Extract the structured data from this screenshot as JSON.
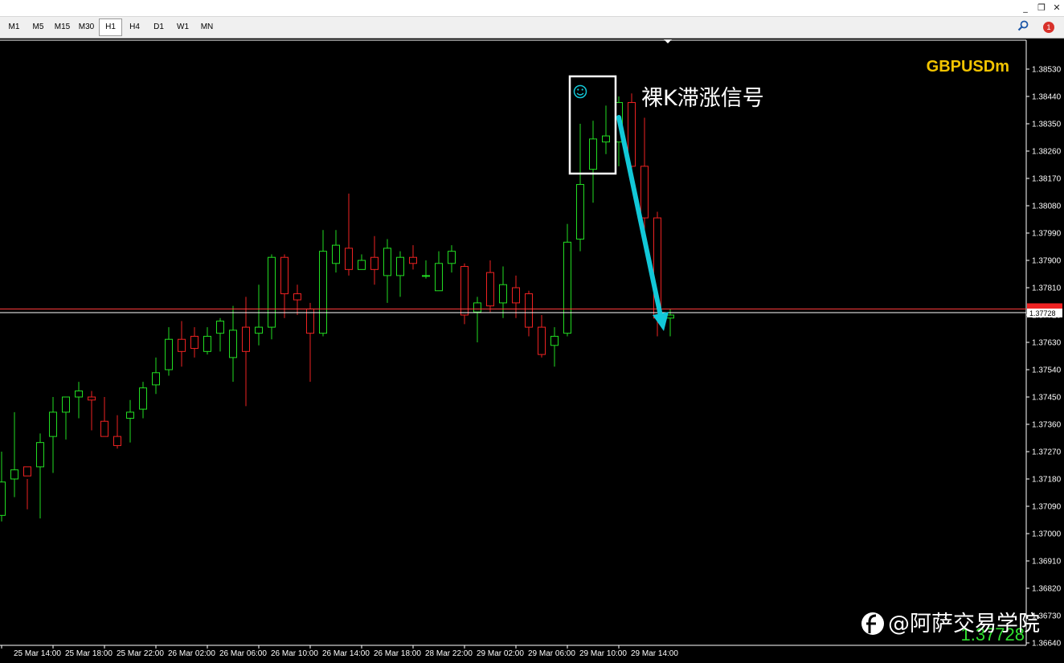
{
  "window": {
    "minimize_icon": "minimize-icon",
    "restore_icon": "restore-icon",
    "close_icon": "close-icon"
  },
  "toolbar": {
    "timeframes": [
      "M1",
      "M5",
      "M15",
      "M30",
      "H1",
      "H4",
      "D1",
      "W1",
      "MN"
    ],
    "active_timeframe": "H1",
    "search_icon": "search-icon",
    "notification_icon": "chat-bubble-icon",
    "notification_count": "1"
  },
  "chart_data": {
    "type": "candlestick",
    "symbol": "GBPUSDm",
    "timeframe": "H1",
    "colors": {
      "bull": "#22dd22",
      "bear": "#ee2222",
      "background": "#000000",
      "annotation_box": "#ffffff",
      "arrow": "#12c8d8"
    },
    "y_axis": {
      "min": 1.3664,
      "max": 1.3853,
      "ticks": [
        "1.38530",
        "1.38440",
        "1.38350",
        "1.38260",
        "1.38170",
        "1.38080",
        "1.37990",
        "1.37900",
        "1.37810",
        "1.37720",
        "1.37630",
        "1.37540",
        "1.37450",
        "1.37360",
        "1.37270",
        "1.37180",
        "1.37090",
        "1.37000",
        "1.36910",
        "1.36820",
        "1.36730",
        "1.36640"
      ]
    },
    "x_axis": {
      "labels": [
        "25 Mar 14:00",
        "25 Mar 18:00",
        "25 Mar 22:00",
        "26 Mar 02:00",
        "26 Mar 06:00",
        "26 Mar 10:00",
        "26 Mar 14:00",
        "26 Mar 18:00",
        "28 Mar 22:00",
        "29 Mar 02:00",
        "29 Mar 06:00",
        "29 Mar 10:00",
        "29 Mar 14:00"
      ]
    },
    "current_price": "1.37728",
    "ask_line_price": 1.3774,
    "bid_display": "1.37728",
    "candles": [
      [
        1.3706,
        1.3727,
        1.3704,
        1.3717
      ],
      [
        1.3718,
        1.374,
        1.3712,
        1.3721
      ],
      [
        1.3722,
        1.3718,
        1.3708,
        1.3719
      ],
      [
        1.3722,
        1.3733,
        1.3705,
        1.373
      ],
      [
        1.3732,
        1.3745,
        1.372,
        1.374
      ],
      [
        1.374,
        1.3742,
        1.3731,
        1.3745
      ],
      [
        1.3745,
        1.375,
        1.3738,
        1.3747
      ],
      [
        1.3745,
        1.3747,
        1.3734,
        1.3744
      ],
      [
        1.3737,
        1.3745,
        1.3733,
        1.3732
      ],
      [
        1.3732,
        1.3739,
        1.3728,
        1.3729
      ],
      [
        1.3738,
        1.3744,
        1.373,
        1.374
      ],
      [
        1.3741,
        1.375,
        1.3738,
        1.3748
      ],
      [
        1.3749,
        1.3758,
        1.3746,
        1.3753
      ],
      [
        1.3754,
        1.3768,
        1.3752,
        1.3764
      ],
      [
        1.3764,
        1.377,
        1.3755,
        1.376
      ],
      [
        1.3765,
        1.3768,
        1.3758,
        1.3761
      ],
      [
        1.376,
        1.3768,
        1.3759,
        1.3765
      ],
      [
        1.3766,
        1.3771,
        1.376,
        1.377
      ],
      [
        1.3758,
        1.3775,
        1.375,
        1.3767
      ],
      [
        1.3768,
        1.3778,
        1.3742,
        1.376
      ],
      [
        1.3766,
        1.3782,
        1.3762,
        1.3768
      ],
      [
        1.3768,
        1.3792,
        1.3764,
        1.3791
      ],
      [
        1.3791,
        1.3792,
        1.3771,
        1.3779
      ],
      [
        1.3779,
        1.3782,
        1.3772,
        1.3777
      ],
      [
        1.3774,
        1.3776,
        1.375,
        1.3766
      ],
      [
        1.3766,
        1.38,
        1.3765,
        1.3793
      ],
      [
        1.3789,
        1.38,
        1.3786,
        1.3795
      ],
      [
        1.3794,
        1.3812,
        1.3785,
        1.3787
      ],
      [
        1.3787,
        1.3792,
        1.3787,
        1.379
      ],
      [
        1.3791,
        1.3798,
        1.3782,
        1.3787
      ],
      [
        1.3785,
        1.3797,
        1.3776,
        1.3794
      ],
      [
        1.3785,
        1.3793,
        1.3778,
        1.3791
      ],
      [
        1.3791,
        1.3795,
        1.3787,
        1.3789
      ],
      [
        1.3785,
        1.379,
        1.3784,
        1.3785
      ],
      [
        1.378,
        1.3793,
        1.378,
        1.3789
      ],
      [
        1.3789,
        1.3795,
        1.3786,
        1.3793
      ],
      [
        1.3788,
        1.3789,
        1.3769,
        1.3772
      ],
      [
        1.3773,
        1.3778,
        1.3763,
        1.3776
      ],
      [
        1.3786,
        1.379,
        1.3773,
        1.3775
      ],
      [
        1.3776,
        1.3788,
        1.3771,
        1.3782
      ],
      [
        1.3781,
        1.3785,
        1.3771,
        1.3776
      ],
      [
        1.3779,
        1.378,
        1.3765,
        1.3768
      ],
      [
        1.3768,
        1.3772,
        1.3758,
        1.3759
      ],
      [
        1.3762,
        1.3768,
        1.3755,
        1.3765
      ],
      [
        1.3766,
        1.3802,
        1.3765,
        1.3796
      ],
      [
        1.3797,
        1.3835,
        1.3793,
        1.3815
      ],
      [
        1.382,
        1.3836,
        1.3809,
        1.383
      ],
      [
        1.3829,
        1.3841,
        1.3825,
        1.3831
      ],
      [
        1.3829,
        1.3844,
        1.3821,
        1.3842
      ],
      [
        1.3842,
        1.3845,
        1.3816,
        1.3821
      ],
      [
        1.3821,
        1.3837,
        1.3797,
        1.3804
      ],
      [
        1.3804,
        1.3806,
        1.3765,
        1.3771
      ],
      [
        1.3771,
        1.3774,
        1.3765,
        1.3772
      ]
    ],
    "annotations": {
      "box_label": "裸K滞涨信号",
      "box_marker": "smiley-icon",
      "arrow": "down-trend-arrow"
    }
  },
  "watermark": {
    "logo": "brand-logo-icon",
    "text": "@阿萨交易学院"
  }
}
